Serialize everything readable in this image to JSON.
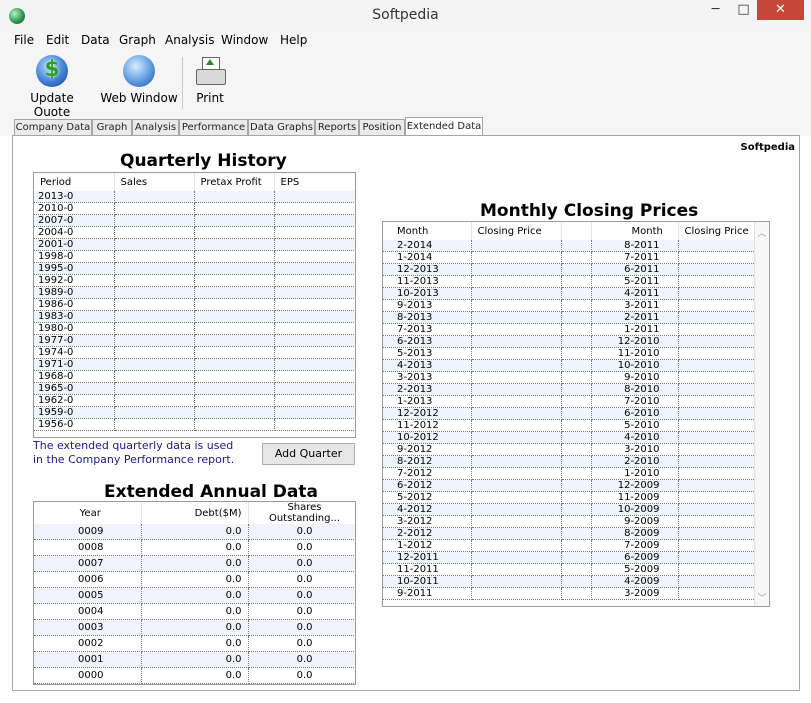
{
  "window": {
    "title": "Softpedia",
    "minimize": "─",
    "maximize": "□",
    "close": "✕"
  },
  "menu": [
    "File",
    "Edit",
    "Data",
    "Graph",
    "Analysis",
    "Window",
    "Help"
  ],
  "toolbar": {
    "update_quote": "Update Quote",
    "web_window": "Web Window",
    "print": "Print"
  },
  "tabs": [
    "Company Data",
    "Graph",
    "Analysis",
    "Performance",
    "Data Graphs",
    "Reports",
    "Position",
    "Extended Data"
  ],
  "active_tab": "Extended Data",
  "panel": {
    "watermark": "Softpedia"
  },
  "quarterly": {
    "title": "Quarterly History",
    "columns": [
      "Period",
      "Sales",
      "Pretax Profit",
      "EPS"
    ],
    "periods": [
      "2013-0",
      "2010-0",
      "2007-0",
      "2004-0",
      "2001-0",
      "1998-0",
      "1995-0",
      "1992-0",
      "1989-0",
      "1986-0",
      "1983-0",
      "1980-0",
      "1977-0",
      "1974-0",
      "1971-0",
      "1968-0",
      "1965-0",
      "1962-0",
      "1959-0",
      "1956-0"
    ]
  },
  "note": "The extended quarterly data is used in the Company Performance report.",
  "add_quarter": "Add Quarter",
  "annual": {
    "title": "Extended Annual Data",
    "columns": [
      "Year",
      "Debt($M)",
      "Shares Outstanding..."
    ],
    "rows": [
      [
        "0009",
        "0.0",
        "0.0"
      ],
      [
        "0008",
        "0.0",
        "0.0"
      ],
      [
        "0007",
        "0.0",
        "0.0"
      ],
      [
        "0006",
        "0.0",
        "0.0"
      ],
      [
        "0005",
        "0.0",
        "0.0"
      ],
      [
        "0004",
        "0.0",
        "0.0"
      ],
      [
        "0003",
        "0.0",
        "0.0"
      ],
      [
        "0002",
        "0.0",
        "0.0"
      ],
      [
        "0001",
        "0.0",
        "0.0"
      ],
      [
        "0000",
        "0.0",
        "0.0"
      ]
    ]
  },
  "monthly": {
    "title": "Monthly Closing Prices",
    "columns": [
      "Month",
      "Closing Price",
      "",
      "Month",
      "Closing Price"
    ],
    "left_months": [
      "2-2014",
      "1-2014",
      "12-2013",
      "11-2013",
      "10-2013",
      "9-2013",
      "8-2013",
      "7-2013",
      "6-2013",
      "5-2013",
      "4-2013",
      "3-2013",
      "2-2013",
      "1-2013",
      "12-2012",
      "11-2012",
      "10-2012",
      "9-2012",
      "8-2012",
      "7-2012",
      "6-2012",
      "5-2012",
      "4-2012",
      "3-2012",
      "2-2012",
      "1-2012",
      "12-2011",
      "11-2011",
      "10-2011",
      "9-2011"
    ],
    "right_months": [
      "8-2011",
      "7-2011",
      "6-2011",
      "5-2011",
      "4-2011",
      "3-2011",
      "2-2011",
      "1-2011",
      "12-2010",
      "11-2010",
      "10-2010",
      "9-2010",
      "8-2010",
      "7-2010",
      "6-2010",
      "5-2010",
      "4-2010",
      "3-2010",
      "2-2010",
      "1-2010",
      "12-2009",
      "11-2009",
      "10-2009",
      "9-2009",
      "8-2009",
      "7-2009",
      "6-2009",
      "5-2009",
      "4-2009",
      "3-2009"
    ]
  }
}
